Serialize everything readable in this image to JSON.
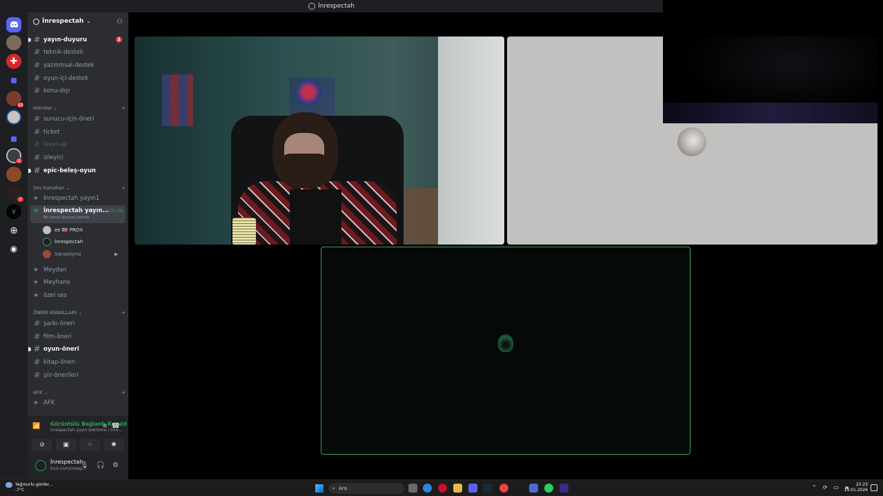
{
  "window": {
    "title": "İnrespectah"
  },
  "guild": {
    "name": "İnrespectah"
  },
  "server_badges": {
    "s3": "10",
    "s6": "2",
    "s8": "7"
  },
  "channels": {
    "text": [
      {
        "name": "yayın-duyuru",
        "badge": "2"
      },
      {
        "name": "teknik-destek"
      },
      {
        "name": "yazılımsal-destek"
      },
      {
        "name": "oyun-içi-destek"
      },
      {
        "name": "konu-dışı"
      }
    ],
    "extras_label": "extralar",
    "extras": [
      {
        "name": "sunucu-için-öneri"
      },
      {
        "name": "ticket"
      },
      {
        "name": "level-up"
      },
      {
        "name": "izleyici"
      },
      {
        "name": "epic-beleş-oyun"
      }
    ],
    "voice_label": "Ses Kanalları",
    "voice": [
      {
        "name": "İnrespectah yayın1"
      },
      {
        "name": "İnrespectah yayın...",
        "timer": "2:30:38",
        "status": "Bir kanal durumu belirle"
      }
    ],
    "voice_users": [
      {
        "name": "ee 🇬🇧 PRDX"
      },
      {
        "name": "İnrespectah"
      },
      {
        "name": "SanatAynsı"
      }
    ],
    "voice_more": [
      {
        "name": "Meydan"
      },
      {
        "name": "Meyhane"
      },
      {
        "name": "özel ses"
      }
    ],
    "suggest_label": "ÖNERİ KANALLARI",
    "suggest": [
      {
        "name": "şarkı-öneri"
      },
      {
        "name": "film-öneri"
      },
      {
        "name": "oyun-öneri"
      },
      {
        "name": "kitap-öneri"
      },
      {
        "name": "şiir-önerileri"
      }
    ],
    "afk_label": "AFK",
    "afk": [
      {
        "name": "AFK"
      }
    ]
  },
  "rtc": {
    "status": "Görüntülü Bağlantı Kuruld",
    "sub": "İnrespectah yayın bekleme / İnre..."
  },
  "user": {
    "name": "İnrespectah",
    "status": "kick.com/inresp..."
  },
  "taskbar": {
    "weather_title": "Yağmurlu günler...",
    "weather_temp": "-7°C",
    "search_placeholder": "Ara",
    "time": "22:23",
    "date": "19.01.2026"
  },
  "colors": {
    "accent_green": "#3ba55c",
    "sidebar": "#2b2d31",
    "rail": "#1e1f22"
  }
}
